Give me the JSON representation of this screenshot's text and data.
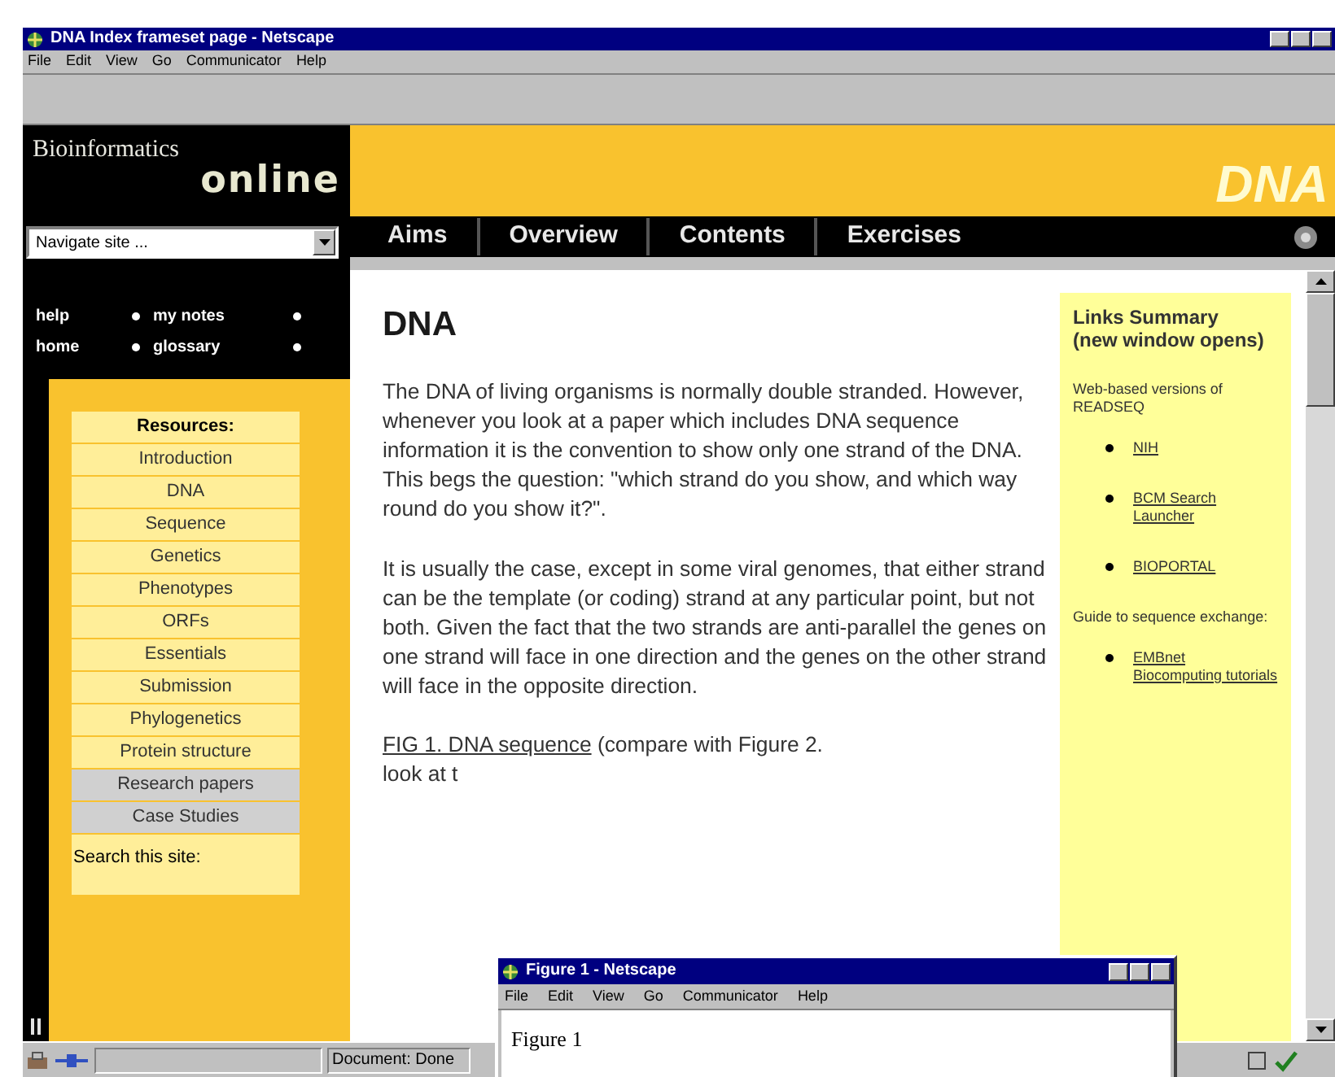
{
  "window": {
    "title": "DNA Index frameset page - Netscape"
  },
  "menu": [
    "File",
    "Edit",
    "View",
    "Go",
    "Communicator",
    "Help"
  ],
  "logo": {
    "line1": "Bioinformatics",
    "line2": "online"
  },
  "navigate": {
    "value": "Navigate site ..."
  },
  "quick_links": [
    "help",
    "my notes",
    "home",
    "glossary"
  ],
  "resources": {
    "heading": "Resources:",
    "items": [
      {
        "label": "Introduction",
        "kind": "topic"
      },
      {
        "label": "DNA",
        "kind": "topic"
      },
      {
        "label": "Sequence",
        "kind": "topic"
      },
      {
        "label": "Genetics",
        "kind": "topic"
      },
      {
        "label": "Phenotypes",
        "kind": "topic"
      },
      {
        "label": "ORFs",
        "kind": "topic"
      },
      {
        "label": "Essentials",
        "kind": "topic"
      },
      {
        "label": "Submission",
        "kind": "topic"
      },
      {
        "label": "Phylogenetics",
        "kind": "topic"
      },
      {
        "label": "Protein structure",
        "kind": "topic"
      },
      {
        "label": "Research papers",
        "kind": "extra"
      },
      {
        "label": "Case Studies",
        "kind": "extra"
      }
    ],
    "search_label": "Search this site:"
  },
  "banner": {
    "title": "DNA"
  },
  "nav_tabs": [
    "Aims",
    "Overview",
    "Contents",
    "Exercises"
  ],
  "article": {
    "heading": "DNA",
    "paragraphs": [
      "The DNA of living organisms is normally double stranded. However, whenever you look at a paper which includes DNA sequence information it is the convention to show only one strand of the DNA. This begs the question: \"which strand do you show, and which way round do you show it?\".",
      "It is usually the case, except in some viral genomes, that either strand can be the template (or coding) strand at any particular point, but not both. Given the fact that the two strands are anti-parallel the genes on one strand will face in one direction and the genes on the other strand will face in the opposite direction."
    ],
    "figure_link": "FIG 1. DNA sequence",
    "figure_text": " (compare with Figure 2.",
    "figure_text_2": "look at t"
  },
  "links_summary": {
    "title": "Links Summary (new window opens)",
    "groups": [
      {
        "intro": "Web-based versions of READSEQ",
        "links": [
          "NIH",
          "BCM Search Launcher",
          "BIOPORTAL"
        ]
      },
      {
        "intro": "Guide to sequence exchange:",
        "links": [
          "EMBnet Biocomputing tutorials"
        ]
      }
    ]
  },
  "popup": {
    "title": "Figure 1 - Netscape",
    "menu": [
      "File",
      "Edit",
      "View",
      "Go",
      "Communicator",
      "Help"
    ],
    "content": "Figure 1"
  },
  "status_bar": {
    "text": "Document: Done"
  }
}
